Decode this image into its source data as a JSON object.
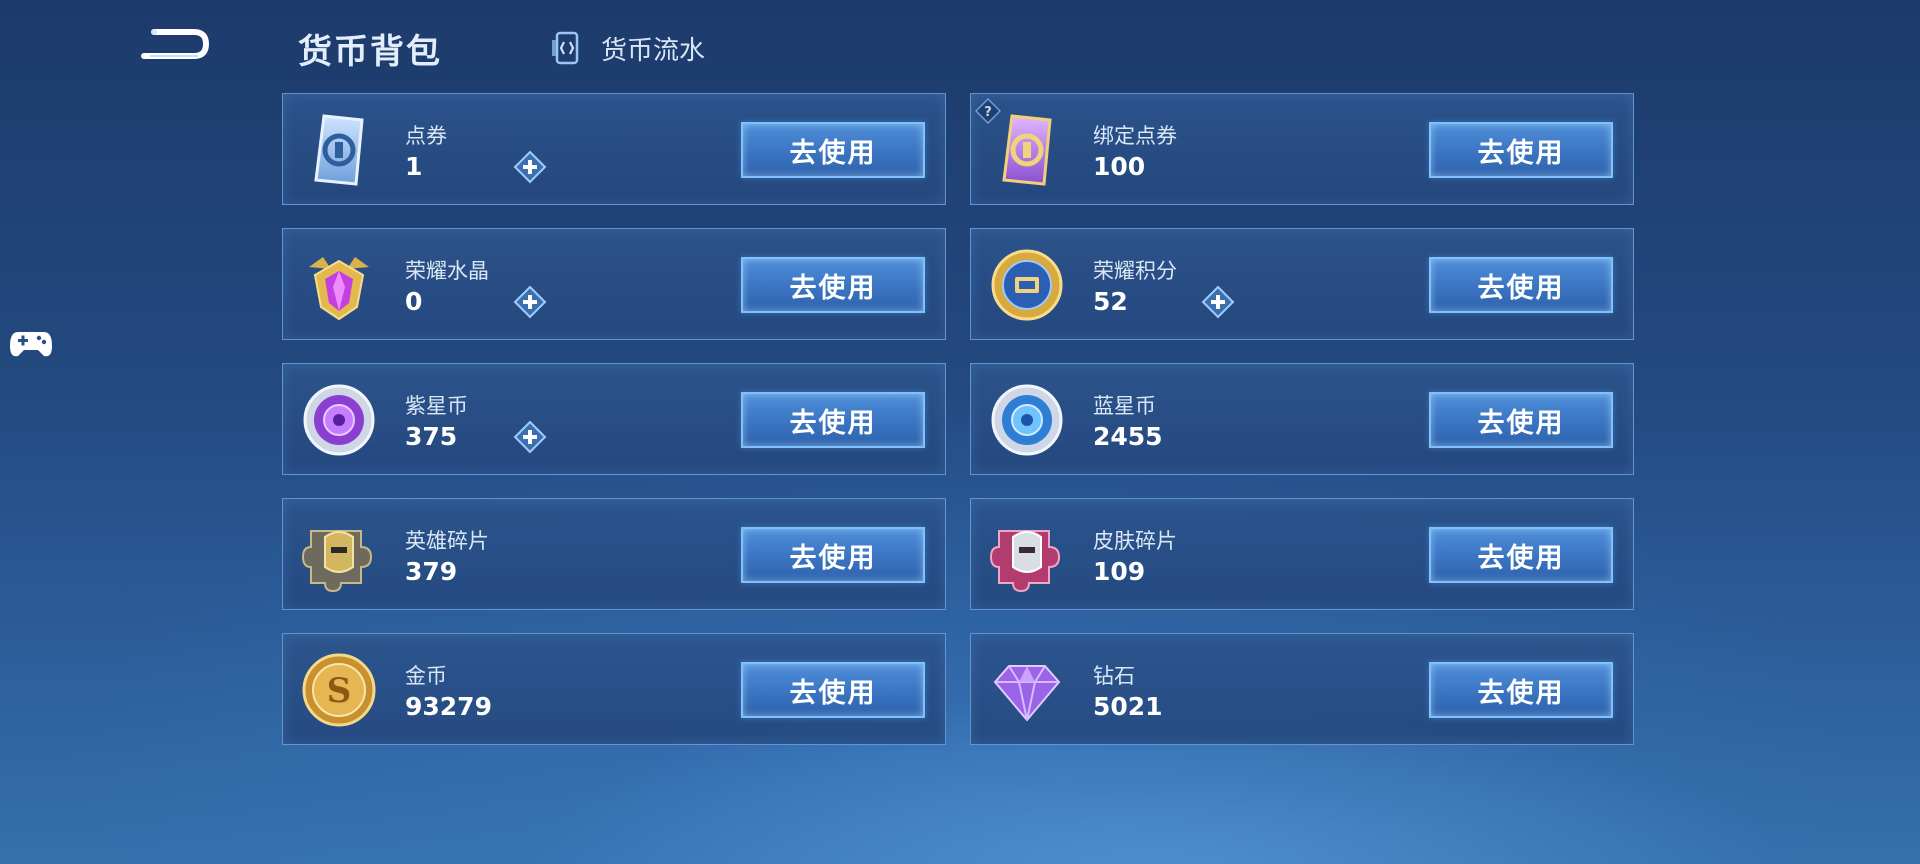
{
  "header": {
    "title": "货币背包",
    "flow_tab_label": "货币流水"
  },
  "currencies": [
    {
      "name": "点券",
      "amount": "1",
      "button": "去使用",
      "icon": "voucher-blue-icon",
      "has_plus": true,
      "has_help": false
    },
    {
      "name": "绑定点券",
      "amount": "100",
      "button": "去使用",
      "icon": "bound-voucher-purple-icon",
      "has_plus": false,
      "has_help": true
    },
    {
      "name": "荣耀水晶",
      "amount": "0",
      "button": "去使用",
      "icon": "glory-crystal-icon",
      "has_plus": true,
      "has_help": false
    },
    {
      "name": "荣耀积分",
      "amount": "52",
      "button": "去使用",
      "icon": "glory-points-icon",
      "has_plus": true,
      "has_help": false
    },
    {
      "name": "紫星币",
      "amount": "375",
      "button": "去使用",
      "icon": "purple-star-coin-icon",
      "has_plus": true,
      "has_help": false
    },
    {
      "name": "蓝星币",
      "amount": "2455",
      "button": "去使用",
      "icon": "blue-star-coin-icon",
      "has_plus": false,
      "has_help": false
    },
    {
      "name": "英雄碎片",
      "amount": "379",
      "button": "去使用",
      "icon": "hero-fragment-icon",
      "has_plus": false,
      "has_help": false
    },
    {
      "name": "皮肤碎片",
      "amount": "109",
      "button": "去使用",
      "icon": "skin-fragment-icon",
      "has_plus": false,
      "has_help": false
    },
    {
      "name": "金币",
      "amount": "93279",
      "button": "去使用",
      "icon": "gold-coin-icon",
      "has_plus": false,
      "has_help": false
    },
    {
      "name": "钻石",
      "amount": "5021",
      "button": "去使用",
      "icon": "diamond-icon",
      "has_plus": false,
      "has_help": false
    }
  ],
  "colors": {
    "accent": "#7fc0ff",
    "button": "#3a74c2",
    "card": "#2c548c"
  }
}
